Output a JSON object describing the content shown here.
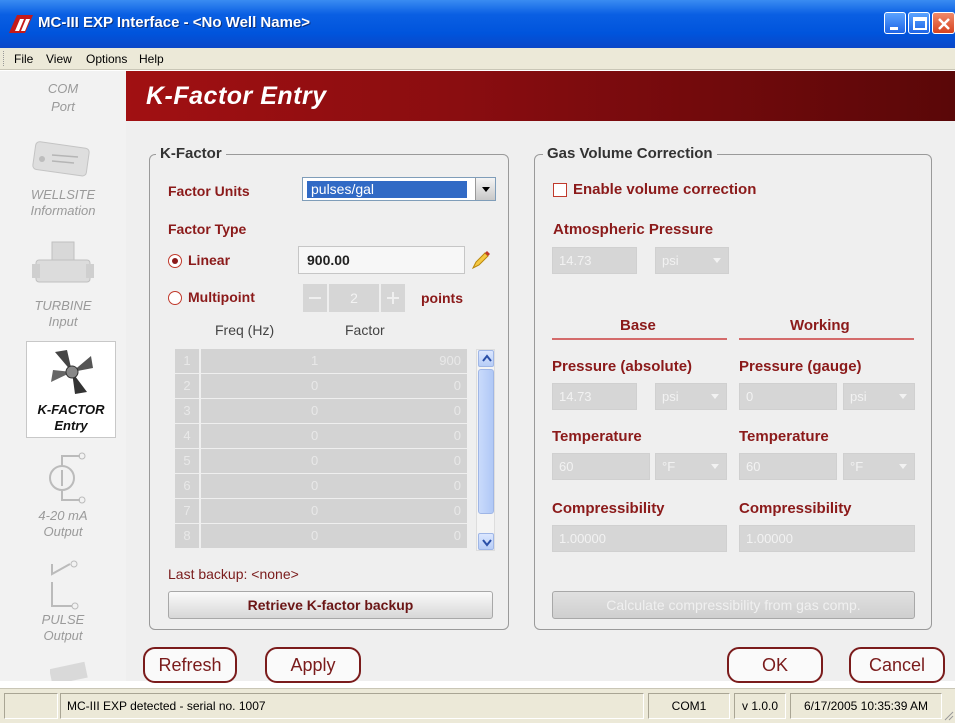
{
  "window": {
    "title": "MC-III EXP Interface - <No Well Name>"
  },
  "menu": {
    "items": [
      "File",
      "View",
      "Options",
      "Help"
    ]
  },
  "sidebar": {
    "items": [
      {
        "l1": "COM",
        "l2": "Port"
      },
      {
        "l1": "WELLSITE",
        "l2": "Information"
      },
      {
        "l1": "TURBINE",
        "l2": "Input"
      },
      {
        "l1": "K-FACTOR",
        "l2": "Entry"
      },
      {
        "l1": "4-20 mA",
        "l2": "Output"
      },
      {
        "l1": "PULSE",
        "l2": "Output"
      }
    ]
  },
  "header": {
    "title": "K-Factor Entry"
  },
  "kfactor": {
    "legend": "K-Factor",
    "factor_units_label": "Factor Units",
    "factor_units_value": "pulses/gal",
    "factor_type_label": "Factor Type",
    "linear_label": "Linear",
    "linear_value": "900.00",
    "multipoint_label": "Multipoint",
    "points_value": "2",
    "points_label": "points",
    "col_freq": "Freq (Hz)",
    "col_factor": "Factor",
    "rows": [
      {
        "n": "1",
        "freq": "1",
        "factor": "900"
      },
      {
        "n": "2",
        "freq": "0",
        "factor": "0"
      },
      {
        "n": "3",
        "freq": "0",
        "factor": "0"
      },
      {
        "n": "4",
        "freq": "0",
        "factor": "0"
      },
      {
        "n": "5",
        "freq": "0",
        "factor": "0"
      },
      {
        "n": "6",
        "freq": "0",
        "factor": "0"
      },
      {
        "n": "7",
        "freq": "0",
        "factor": "0"
      },
      {
        "n": "8",
        "freq": "0",
        "factor": "0"
      }
    ],
    "last_backup_label": "Last backup:",
    "last_backup_value": "<none>",
    "retrieve_button": "Retrieve K-factor backup"
  },
  "gas": {
    "legend": "Gas Volume Correction",
    "enable_label": "Enable volume correction",
    "atm_label": "Atmospheric Pressure",
    "atm_value": "14.73",
    "atm_unit": "psi",
    "base_heading": "Base",
    "working_heading": "Working",
    "base_pressure_label": "Pressure (absolute)",
    "working_pressure_label": "Pressure (gauge)",
    "base_pressure_value": "14.73",
    "base_pressure_unit": "psi",
    "working_pressure_value": "0",
    "working_pressure_unit": "psi",
    "base_temp_label": "Temperature",
    "working_temp_label": "Temperature",
    "base_temp_value": "60",
    "base_temp_unit": "°F",
    "working_temp_value": "60",
    "working_temp_unit": "°F",
    "base_comp_label": "Compressibility",
    "working_comp_label": "Compressibility",
    "base_comp_value": "1.00000",
    "working_comp_value": "1.00000",
    "calc_button": "Calculate compressibility from gas comp."
  },
  "actions": {
    "refresh": "Refresh",
    "apply": "Apply",
    "ok": "OK",
    "cancel": "Cancel"
  },
  "status": {
    "message": "MC-III EXP detected - serial no. 1007",
    "port": "COM1",
    "version": "v 1.0.0",
    "datetime": "6/17/2005 10:35:39 AM"
  }
}
